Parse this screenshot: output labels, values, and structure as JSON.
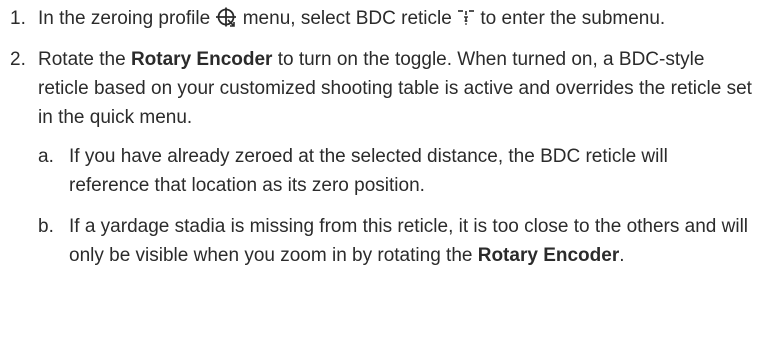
{
  "steps": [
    {
      "number": "1.",
      "text_before_icon1": "In the zeroing profile ",
      "icon1": "zeroing-profile-icon",
      "text_between_icons": " menu, select BDC reticle ",
      "icon2": "bdc-reticle-icon",
      "text_after_icon2": " to enter the submenu."
    },
    {
      "number": "2.",
      "text_before_bold": "Rotate the ",
      "bold": "Rotary Encoder",
      "text_after_bold": " to turn on the toggle. When turned on, a BDC-style reticle based on your customized shooting table is active and overrides the reticle set in the quick menu.",
      "substeps": [
        {
          "letter": "a.",
          "text": "If you have already zeroed at the selected distance, the BDC reticle will reference that location as its zero position."
        },
        {
          "letter": "b.",
          "text_before_bold": "If a yardage stadia is missing from this reticle, it is too close to the others and will only be visible when you zoom in by rotating the ",
          "bold": "Rotary Encoder",
          "text_after_bold": "."
        }
      ]
    }
  ]
}
